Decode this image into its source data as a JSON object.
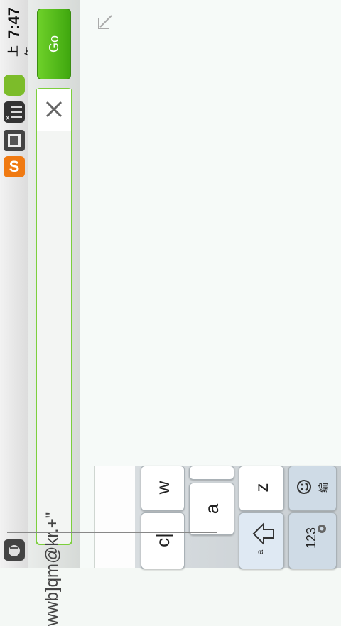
{
  "status_bar": {
    "time": "7:47",
    "ampm": "上午",
    "icons": [
      "chat-notification-icon",
      "task-manager-icon",
      "sim-card-icon",
      "sogou-input-icon",
      "android-debug-icon"
    ],
    "sogou_letter": "S"
  },
  "url_bar": {
    "go_label": "Go",
    "url_value": "wwb]qm@kr.+\""
  },
  "keyboard": {
    "keys": {
      "w": "w",
      "c": "c|",
      "a": "a",
      "z": "z",
      "shift_sub": "a",
      "num": "123",
      "emoji_sub": "编"
    }
  },
  "colors": {
    "accent_green": "#4cb818",
    "field_border": "#7ccf3c",
    "sogou_orange": "#f07a12"
  }
}
